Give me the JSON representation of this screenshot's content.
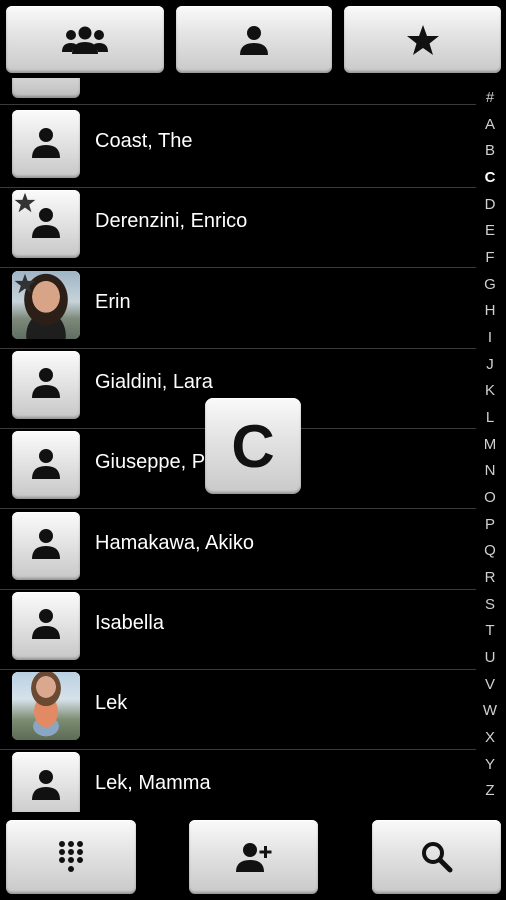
{
  "tabs": [
    {
      "id": "groups",
      "icon": "groups-icon"
    },
    {
      "id": "contacts",
      "icon": "person-icon"
    },
    {
      "id": "favorites",
      "icon": "star-icon"
    }
  ],
  "contacts": [
    {
      "name": "Coast, The",
      "avatar": "default",
      "starred": false
    },
    {
      "name": "Derenzini, Enrico",
      "avatar": "default",
      "starred": true
    },
    {
      "name": "Erin",
      "avatar": "photo",
      "starred": true
    },
    {
      "name": "Gialdini, Lara",
      "avatar": "default",
      "starred": false
    },
    {
      "name": "Giuseppe, Pa",
      "avatar": "default",
      "starred": false
    },
    {
      "name": "Hamakawa, Akiko",
      "avatar": "default",
      "starred": false
    },
    {
      "name": "Isabella",
      "avatar": "default",
      "starred": false
    },
    {
      "name": "Lek",
      "avatar": "photo",
      "starred": false
    },
    {
      "name": "Lek, Mamma",
      "avatar": "default",
      "starred": false
    }
  ],
  "alphabet": {
    "letters": [
      "#",
      "A",
      "B",
      "C",
      "D",
      "E",
      "F",
      "G",
      "H",
      "I",
      "J",
      "K",
      "L",
      "M",
      "N",
      "O",
      "P",
      "Q",
      "R",
      "S",
      "T",
      "U",
      "V",
      "W",
      "X",
      "Y",
      "Z"
    ],
    "active": "C"
  },
  "popup": {
    "letter": "C"
  },
  "bottom_bar": [
    {
      "id": "dialpad",
      "icon": "dialpad-icon"
    },
    {
      "id": "add-contact",
      "icon": "add-person-icon"
    },
    {
      "id": "search",
      "icon": "search-icon"
    }
  ],
  "colors": {
    "background": "#000000",
    "text": "#ffffff",
    "icon": "#111111"
  }
}
